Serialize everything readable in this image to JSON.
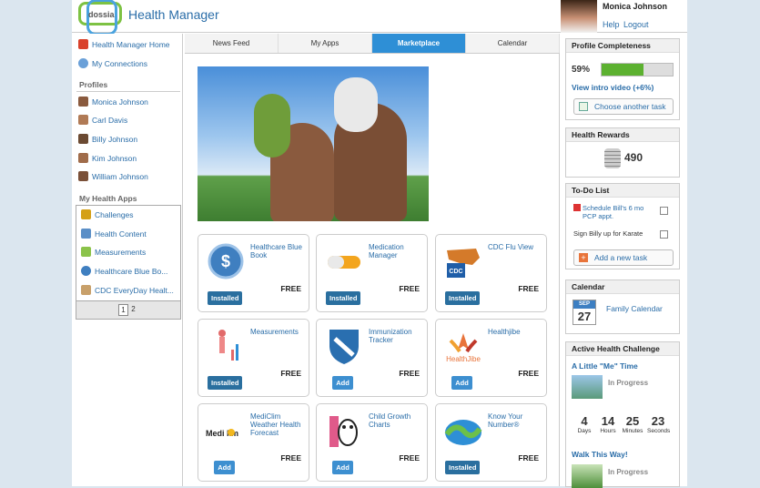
{
  "header": {
    "brand": "dossia",
    "title": "Health Manager",
    "user_name": "Monica Johnson",
    "help": "Help",
    "logout": "Logout"
  },
  "left": {
    "home": "Health Manager Home",
    "connections": "My Connections",
    "profiles_title": "Profiles",
    "profiles": [
      "Monica Johnson",
      "Carl Davis",
      "Billy Johnson",
      "Kim Johnson",
      "William Johnson"
    ],
    "apps_title": "My Health Apps",
    "apps": [
      "Challenges",
      "Health Content",
      "Measurements",
      "Healthcare Blue Bo...",
      "CDC EveryDay Healt..."
    ],
    "pages": [
      "1",
      "2"
    ]
  },
  "tabs": [
    "News Feed",
    "My Apps",
    "Marketplace",
    "Calendar"
  ],
  "active_tab": "Marketplace",
  "cards": [
    {
      "name": "Healthcare Blue Book",
      "price": "FREE",
      "action": "Installed",
      "icon": "blue-book-icon"
    },
    {
      "name": "Medication Manager",
      "price": "FREE",
      "action": "Installed",
      "icon": "pill-icon"
    },
    {
      "name": "CDC Flu View",
      "price": "FREE",
      "action": "Installed",
      "icon": "cdc-map-icon"
    },
    {
      "name": "Measurements",
      "price": "FREE",
      "action": "Installed",
      "icon": "body-chart-icon"
    },
    {
      "name": "Immunization Tracker",
      "price": "FREE",
      "action": "Add",
      "icon": "shield-syringe-icon"
    },
    {
      "name": "Healthjibe",
      "price": "FREE",
      "action": "Add",
      "icon": "healthjibe-logo-icon"
    },
    {
      "name": "MediClim Weather Health Forecast",
      "price": "FREE",
      "action": "Add",
      "icon": "mediclim-logo-icon",
      "logo_text": "Medi lim"
    },
    {
      "name": "Child Growth Charts",
      "price": "FREE",
      "action": "Add",
      "icon": "panda-icon"
    },
    {
      "name": "Know Your Number®",
      "price": "FREE",
      "action": "Installed",
      "icon": "wave-logo-icon"
    }
  ],
  "healthjibe_logo": "HealthJibe",
  "cdc_logo": "CDC",
  "profile": {
    "title": "Profile Completeness",
    "percent_label": "59%",
    "percent": 59,
    "intro": "View intro video (+6%)",
    "choose": "Choose another task"
  },
  "rewards": {
    "title": "Health Rewards",
    "points": "490"
  },
  "todo": {
    "title": "To-Do List",
    "items": [
      "Schedule Bill's 6 mo PCP appt.",
      "Sign Billy up for Karate"
    ],
    "add": "Add a new task"
  },
  "calendar": {
    "title": "Calendar",
    "month": "SEP",
    "day": "27",
    "label": "Family Calendar"
  },
  "challenge": {
    "title": "Active Health Challenge",
    "c1": "A Little \"Me\" Time",
    "status": "In Progress",
    "countdown": [
      {
        "n": "4",
        "u": "Days"
      },
      {
        "n": "14",
        "u": "Hours"
      },
      {
        "n": "25",
        "u": "Minutes"
      },
      {
        "n": "23",
        "u": "Seconds"
      }
    ],
    "c2": "Walk This Way!"
  },
  "colors": {
    "accent": "#2e8fd6",
    "installed": "#2a6f9f",
    "progress": "#5cb130"
  }
}
